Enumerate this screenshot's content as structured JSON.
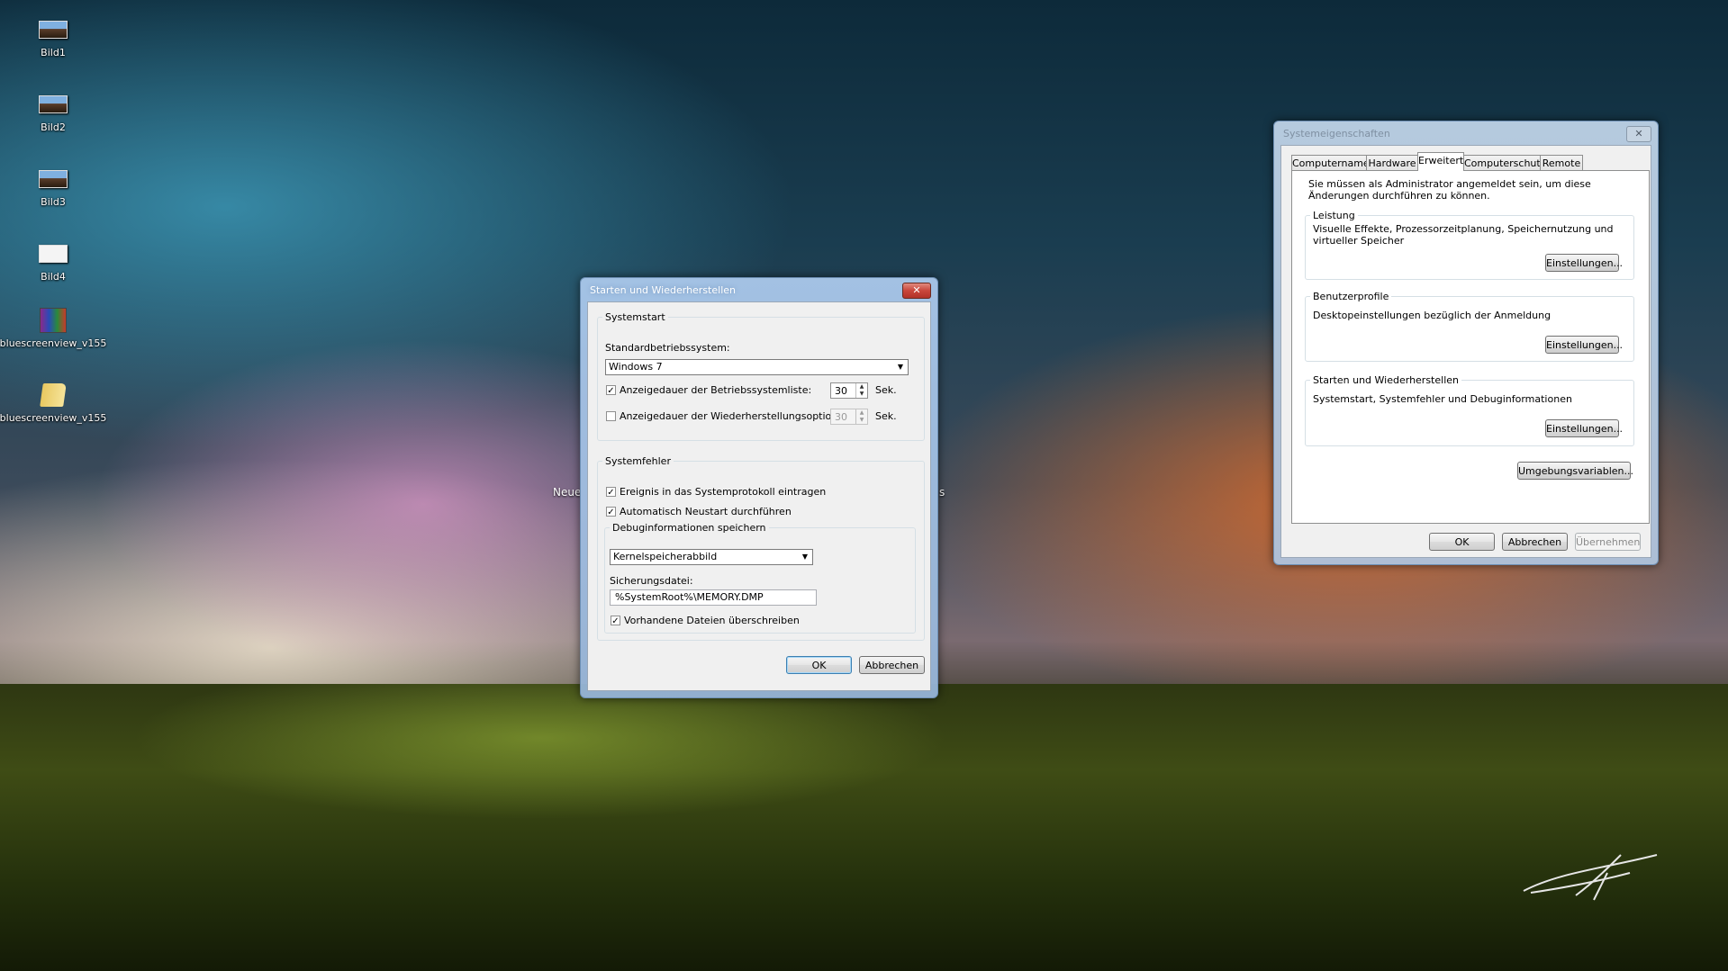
{
  "desktop": {
    "icons": [
      {
        "label": "Bild1",
        "glyph": "image-icon"
      },
      {
        "label": "Bild2",
        "glyph": "image-icon"
      },
      {
        "label": "Bild3",
        "glyph": "image-icon"
      },
      {
        "label": "Bild4",
        "glyph": "image-icon"
      },
      {
        "label": "bluescreenview_v155",
        "glyph": "winrar-archive-icon"
      },
      {
        "label": "bluescreenview_v155",
        "glyph": "folder-icon"
      }
    ],
    "fragment_left": "Neue",
    "fragment_right": "s"
  },
  "startup_dialog": {
    "title": "Starten und Wiederherstellen",
    "close_label": "✕",
    "systemstart": {
      "legend": "Systemstart",
      "default_os_label": "Standardbetriebssystem:",
      "default_os_value": "Windows 7",
      "os_list_label": "Anzeigedauer der Betriebssystemliste:",
      "os_list_checked": true,
      "os_list_seconds": "30",
      "recovery_label": "Anzeigedauer der Wiederherstellungsoptionen:",
      "recovery_checked": false,
      "recovery_seconds": "30",
      "unit": "Sek."
    },
    "systemfehler": {
      "legend": "Systemfehler",
      "log_event_label": "Ereignis in das Systemprotokoll eintragen",
      "log_event_checked": true,
      "auto_restart_label": "Automatisch Neustart durchführen",
      "auto_restart_checked": true,
      "debug": {
        "legend": "Debuginformationen speichern",
        "dump_type": "Kernelspeicherabbild",
        "dump_file_label": "Sicherungsdatei:",
        "dump_file_value": "%SystemRoot%\\MEMORY.DMP",
        "overwrite_label": "Vorhandene Dateien überschreiben",
        "overwrite_checked": true
      }
    },
    "ok_label": "OK",
    "cancel_label": "Abbrechen"
  },
  "sysprops_dialog": {
    "title": "Systemeigenschaften",
    "close_label": "✕",
    "tabs": [
      "Computername",
      "Hardware",
      "Erweitert",
      "Computerschutz",
      "Remote"
    ],
    "active_tab": "Erweitert",
    "admin_note": "Sie müssen als Administrator angemeldet sein, um diese Änderungen durchführen zu können.",
    "performance": {
      "legend": "Leistung",
      "description": "Visuelle Effekte, Prozessorzeitplanung, Speichernutzung und virtueller Speicher",
      "button": "Einstellungen..."
    },
    "user_profiles": {
      "legend": "Benutzerprofile",
      "description": "Desktopeinstellungen bezüglich der Anmeldung",
      "button": "Einstellungen..."
    },
    "startup_recovery": {
      "legend": "Starten und Wiederherstellen",
      "description": "Systemstart, Systemfehler und Debuginformationen",
      "button": "Einstellungen..."
    },
    "env_button": "Umgebungsvariablen...",
    "ok_label": "OK",
    "cancel_label": "Abbrechen",
    "apply_label": "Übernehmen"
  },
  "colors": {
    "close_red": "#c9463b",
    "close_gray": "#b8c8d8",
    "accent_blue": "#3c7fb1"
  }
}
